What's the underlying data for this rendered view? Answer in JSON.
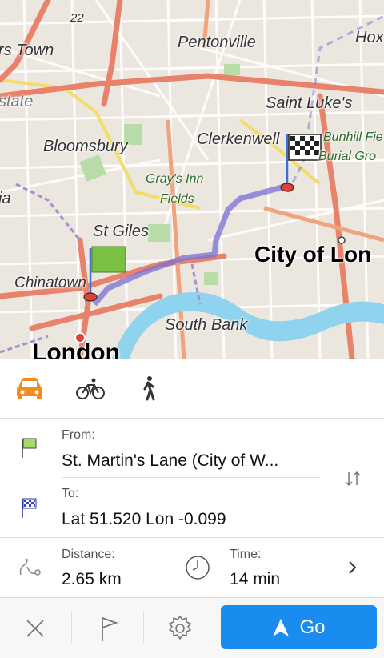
{
  "map": {
    "labels": {
      "pentonville": "Pentonville",
      "hox": "Hox",
      "town": "rs Town",
      "estate": "state",
      "saint_lukes": "Saint Luke's",
      "bloomsbury": "Bloomsbury",
      "clerkenwell": "Clerkenwell",
      "bunhill": "Bunhill Fie",
      "burial": "Burial Gro",
      "grays_inn": "Gray's Inn",
      "fields": "Fields",
      "ia": "ia",
      "st_giles": "St Giles",
      "city_of_london": "City of Lon",
      "chinatown": "Chinatown",
      "south_bank": "South Bank",
      "london": "London",
      "road_22": "22"
    },
    "colors": {
      "route": "#7a6fd6",
      "start_flag": "#7ac143",
      "river": "#8fd3ee",
      "major_road": "#e8826a"
    }
  },
  "transport_modes": [
    {
      "name": "car",
      "icon": "car-icon",
      "selected": true
    },
    {
      "name": "bicycle",
      "icon": "bicycle-icon",
      "selected": false
    },
    {
      "name": "walk",
      "icon": "pedestrian-icon",
      "selected": false
    }
  ],
  "route": {
    "from_label": "From:",
    "from_value": "St. Martin's Lane (City of W...",
    "to_label": "To:",
    "to_value": "Lat 51.520 Lon -0.099",
    "distance_label": "Distance:",
    "distance_value": "2.65 km",
    "time_label": "Time:",
    "time_value": "14 min"
  },
  "toolbar": {
    "go_label": "Go",
    "accent": "#1a8cf0"
  }
}
